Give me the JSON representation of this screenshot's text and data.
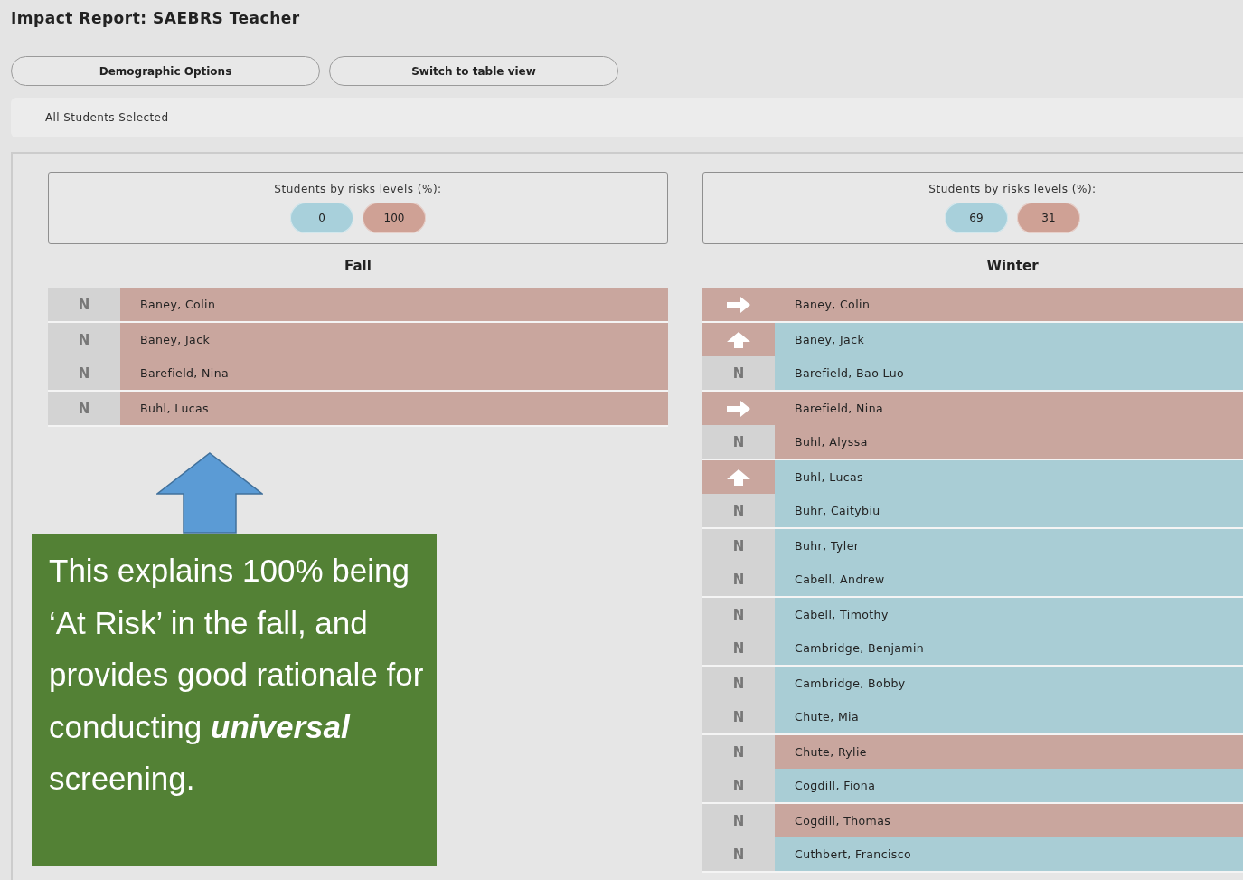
{
  "title": "Impact Report: SAEBRS Teacher",
  "buttons": [
    "Demographic Options",
    "Switch to table view"
  ],
  "filter_text": "All Students Selected",
  "columns": [
    {
      "summary": {
        "label": "Students by risks levels (%):",
        "pills": [
          {
            "color": "#a8d0db",
            "value": "0"
          },
          {
            "color": "#cfa195",
            "value": "100"
          }
        ]
      },
      "heading": "Fall",
      "groups": [
        [
          {
            "kind": "none",
            "mark": "N",
            "name": "Baney, Colin",
            "color": "#c9a69e"
          }
        ],
        [
          {
            "kind": "none",
            "mark": "N",
            "name": "Baney, Jack",
            "color": "#c9a69e"
          },
          {
            "kind": "none",
            "mark": "N",
            "name": "Barefield, Nina",
            "color": "#c9a69e"
          }
        ],
        [
          {
            "kind": "none",
            "mark": "N",
            "name": "Buhl, Lucas",
            "color": "#c9a69e"
          }
        ]
      ]
    },
    {
      "summary": {
        "label": "Students by risks levels (%):",
        "pills": [
          {
            "color": "#a8d0db",
            "value": "69"
          },
          {
            "color": "#cfa195",
            "value": "31"
          }
        ]
      },
      "heading": "Winter",
      "groups": [
        [
          {
            "kind": "same",
            "name": "Baney, Colin",
            "color": "#c9a69e"
          }
        ],
        [
          {
            "kind": "up",
            "name": "Baney, Jack",
            "color": "#a9cdd5"
          },
          {
            "kind": "none",
            "mark": "N",
            "name": "Barefield, Bao Luo",
            "color": "#a9cdd5"
          }
        ],
        [
          {
            "kind": "same",
            "name": "Barefield, Nina",
            "color": "#c9a69e"
          },
          {
            "kind": "none",
            "mark": "N",
            "name": "Buhl, Alyssa",
            "color": "#c9a69e"
          }
        ],
        [
          {
            "kind": "up",
            "name": "Buhl, Lucas",
            "color": "#a9cdd5"
          },
          {
            "kind": "none",
            "mark": "N",
            "name": "Buhr, Caitybiu",
            "color": "#a9cdd5"
          }
        ],
        [
          {
            "kind": "none",
            "mark": "N",
            "name": "Buhr, Tyler",
            "color": "#a9cdd5"
          },
          {
            "kind": "none",
            "mark": "N",
            "name": "Cabell, Andrew",
            "color": "#a9cdd5"
          }
        ],
        [
          {
            "kind": "none",
            "mark": "N",
            "name": "Cabell, Timothy",
            "color": "#a9cdd5"
          },
          {
            "kind": "none",
            "mark": "N",
            "name": "Cambridge, Benjamin",
            "color": "#a9cdd5"
          }
        ],
        [
          {
            "kind": "none",
            "mark": "N",
            "name": "Cambridge, Bobby",
            "color": "#a9cdd5"
          },
          {
            "kind": "none",
            "mark": "N",
            "name": "Chute, Mia",
            "color": "#a9cdd5"
          }
        ],
        [
          {
            "kind": "none",
            "mark": "N",
            "name": "Chute, Rylie",
            "color": "#c9a69e"
          },
          {
            "kind": "none",
            "mark": "N",
            "name": "Cogdill, Fiona",
            "color": "#a9cdd5"
          }
        ],
        [
          {
            "kind": "none",
            "mark": "N",
            "name": "Cogdill, Thomas",
            "color": "#c9a69e"
          },
          {
            "kind": "none",
            "mark": "N",
            "name": "Cuthbert, Francisco",
            "color": "#a9cdd5"
          }
        ]
      ]
    }
  ],
  "callout": {
    "text": "This explains 100% being ‘At Risk’ in the fall, and provides good rationale for conducting **universal** screening."
  }
}
